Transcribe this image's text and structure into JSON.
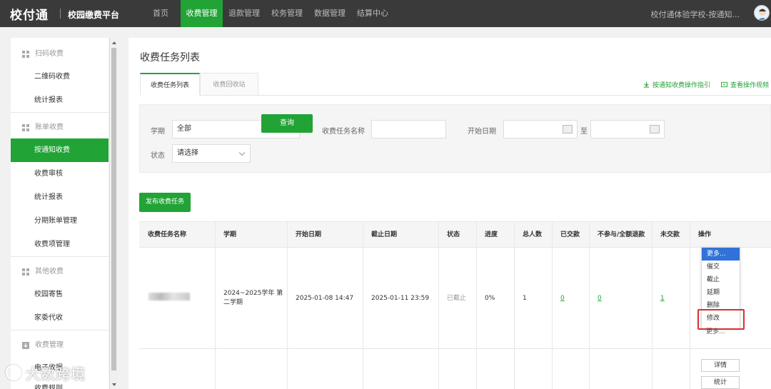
{
  "header": {
    "logo": "校付通",
    "platform": "校园缴费平台",
    "nav": [
      "首页",
      "收费管理",
      "退款管理",
      "校务管理",
      "数据管理",
      "结算中心"
    ],
    "active_nav": "收费管理",
    "school": "校付通体验学校-按通知..."
  },
  "sidebar": {
    "group_scan": "扫码收费",
    "qr": "二维码收费",
    "report1": "统计报表",
    "group_bill": "账单收费",
    "notice": "按通知收费",
    "audit": "收费审核",
    "report2": "统计报表",
    "installment": "分期账单管理",
    "items": "收费项管理",
    "group_other": "其他收费",
    "mail": "校园寄售",
    "proxy": "家委代收",
    "group_manage": "收费管理",
    "receipt": "电子收据",
    "more": "收费规则"
  },
  "main": {
    "title": "收费任务列表",
    "tab_list": "收费任务列表",
    "tab_recycle": "收费回收站",
    "guide": "按通知收费操作指引",
    "video": "查看操作视频"
  },
  "filter": {
    "term_label": "学期",
    "term_value": "全部",
    "name_label": "收费任务名称",
    "name_value": "",
    "start_label": "开始日期",
    "to": "至",
    "status_label": "状态",
    "status_value": "请选择",
    "query": "查询"
  },
  "publish": "发布收费任务",
  "table": {
    "columns": [
      "收费任务名称",
      "学期",
      "开始日期",
      "截止日期",
      "状态",
      "进度",
      "总人数",
      "已交款",
      "不参与/全额退款",
      "未交款",
      "操作"
    ],
    "row": {
      "term": "2024~2025学年 第二学期",
      "start": "2025-01-08 14:47",
      "end": "2025-01-11 23:59",
      "status": "已截止",
      "progress": "0%",
      "total": "1",
      "paid": "0",
      "refund": "0",
      "unpaid": "1"
    }
  },
  "dropdown": {
    "items": [
      "更多...",
      "催交",
      "截止",
      "延期",
      "删除",
      "修改"
    ],
    "active": "更多...",
    "under": "更多..."
  },
  "row2_actions": {
    "detail": "详情",
    "stats": "统计"
  },
  "watermark": "大数跨境"
}
